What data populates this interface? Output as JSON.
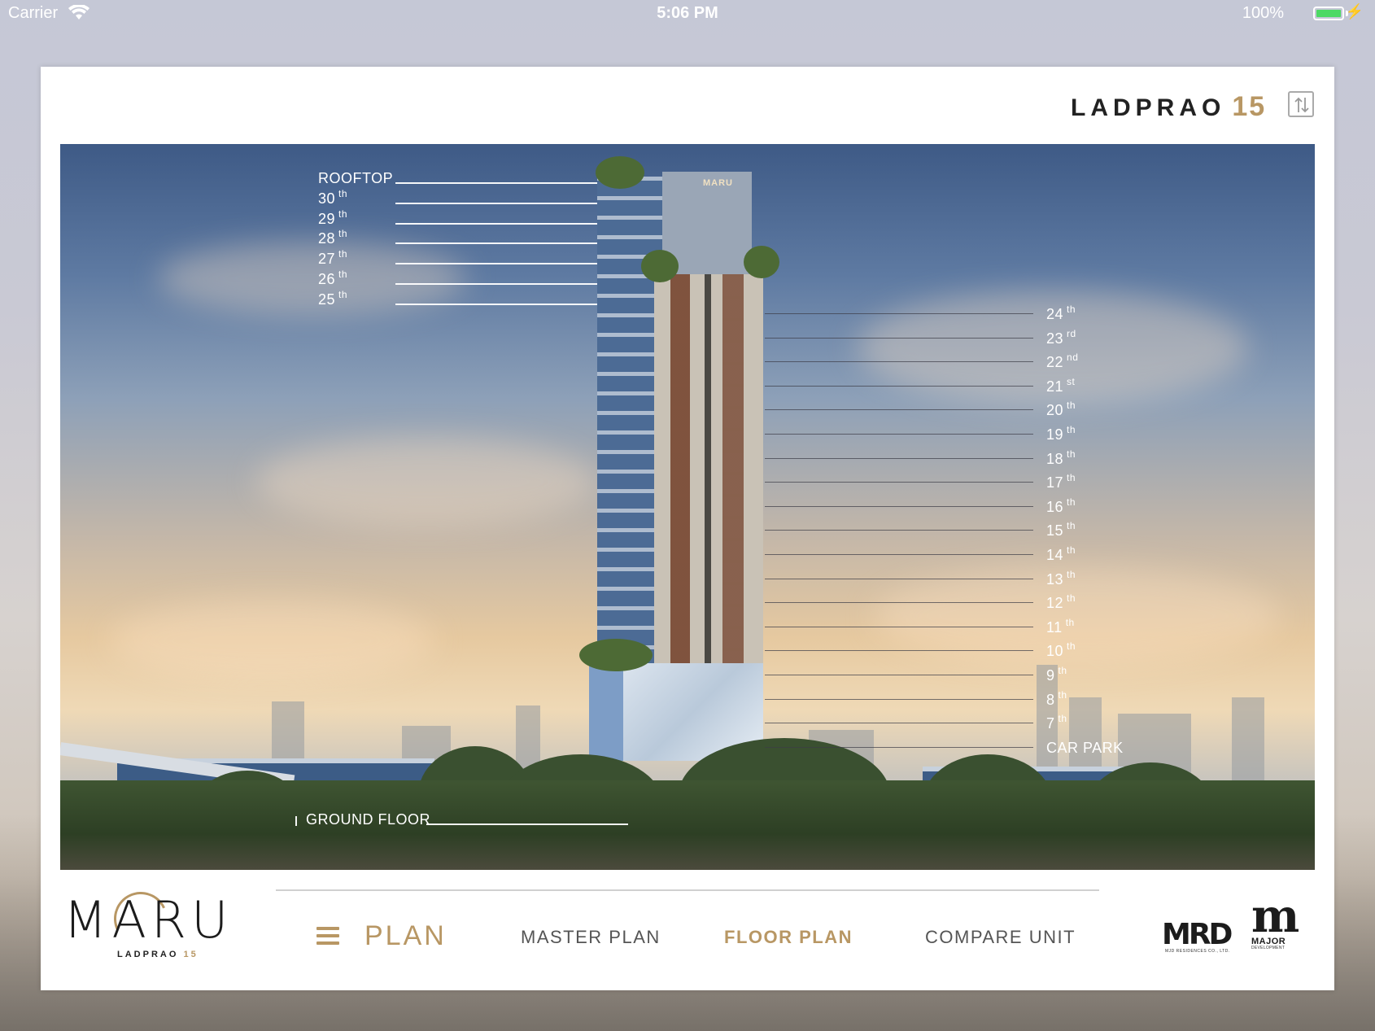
{
  "status_bar": {
    "carrier": "Carrier",
    "time": "5:06 PM",
    "battery": "100%",
    "battery_level": 1.0
  },
  "header": {
    "brand_name": "LADPRAO",
    "brand_number": "15",
    "swap_icon": "swap-vertical-icon"
  },
  "floors_left": [
    {
      "num": "ROOFTOP",
      "suffix": ""
    },
    {
      "num": "30",
      "suffix": "th"
    },
    {
      "num": "29",
      "suffix": "th"
    },
    {
      "num": "28",
      "suffix": "th"
    },
    {
      "num": "27",
      "suffix": "th"
    },
    {
      "num": "26",
      "suffix": "th"
    },
    {
      "num": "25",
      "suffix": "th"
    }
  ],
  "floors_right": [
    {
      "num": "24",
      "suffix": "th"
    },
    {
      "num": "23",
      "suffix": "rd"
    },
    {
      "num": "22",
      "suffix": "nd"
    },
    {
      "num": "21",
      "suffix": "st"
    },
    {
      "num": "20",
      "suffix": "th"
    },
    {
      "num": "19",
      "suffix": "th"
    },
    {
      "num": "18",
      "suffix": "th"
    },
    {
      "num": "17",
      "suffix": "th"
    },
    {
      "num": "16",
      "suffix": "th"
    },
    {
      "num": "15",
      "suffix": "th"
    },
    {
      "num": "14",
      "suffix": "th"
    },
    {
      "num": "13",
      "suffix": "th"
    },
    {
      "num": "12",
      "suffix": "th"
    },
    {
      "num": "11",
      "suffix": "th"
    },
    {
      "num": "10",
      "suffix": "th"
    },
    {
      "num": "9",
      "suffix": "th"
    },
    {
      "num": "8",
      "suffix": "th"
    },
    {
      "num": "7",
      "suffix": "th"
    },
    {
      "num": "CAR PARK",
      "suffix": ""
    }
  ],
  "ground_floor": "GROUND FLOOR",
  "tower_sign": "MARU",
  "footer": {
    "logo_word": "MARU",
    "logo_sub": "LADPRAO",
    "logo_sub_num": "15",
    "menu_label": "PLAN",
    "nav": [
      {
        "label": "MASTER PLAN",
        "active": false
      },
      {
        "label": "FLOOR PLAN",
        "active": true
      },
      {
        "label": "COMPARE UNIT",
        "active": false
      }
    ],
    "mrd_logo": "MRD",
    "mrd_sub": "MJD RESIDENCES CO., LTD.",
    "major_logo": "m",
    "major_sub": "MAJOR",
    "major_sub2": "DEVELOPMENT"
  },
  "colors": {
    "accent_gold": "#b89764",
    "text_dark": "#1c1c1c",
    "battery_green": "#4cd964"
  }
}
